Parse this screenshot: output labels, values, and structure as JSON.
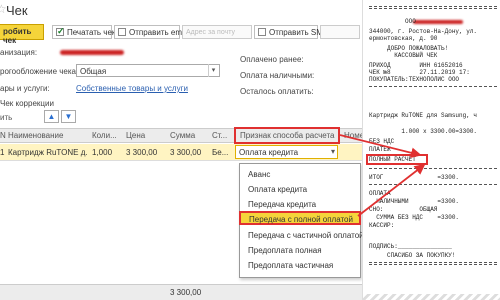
{
  "window": {
    "title": "Чек"
  },
  "toolbar": {
    "print_button": "робить чек",
    "print_check": "Печатать чек",
    "send_email": "Отправить email",
    "email_placeholder": "Адрес за почту",
    "send_sms": "Отправить SMS"
  },
  "form": {
    "org_label": "анизация:",
    "tax_label": "рогообложение чека:",
    "tax_value": "Общая",
    "goods_label": "ары и услуги:",
    "goods_link": "Собственные товары и услуги",
    "correction_label": "Чек коррекции",
    "paid_before_label": "Оплачено ранее:",
    "cash_label": "Оплата наличными:",
    "remaining_label": "Осталось оплатить:"
  },
  "grid": {
    "headers": [
      "N",
      "Наименование",
      "Коли...",
      "Цена",
      "Сумма",
      "Ст...",
      "Признак способа расчета",
      "Номе"
    ],
    "row": {
      "num": "1",
      "name": "Картридж RuTONE д...",
      "qty": "1,000",
      "price": "3 300,00",
      "sum": "3 300,00",
      "tax": "Бе...",
      "method": "Оплата кредита"
    },
    "footer_sum": "3 300,00"
  },
  "dropdown": {
    "items": [
      "Аванс",
      "Оплата кредита",
      "Передача кредита",
      "Передача с полной оплатой",
      "Передача с частичной оплатой",
      "Предоплата полная",
      "Предоплата частичная"
    ],
    "selected_index": 3
  },
  "receipt": {
    "lines": [
      "          ООО",
      "344000, г. Ростов-На-Дону, ул.",
      "ермонтовская, д. 90",
      "     ДОБРО ПОЖАЛОВАТЬ!",
      "       КАССОВЫЙ ЧЕК",
      "ПРИХОД        ИНН 61652016",
      "ЧЕК №8        27.11.2019 17:",
      "ПОКУПАТЕЛЬ:ТЕХНОПОЛИС ООО",
      "",
      "Картридж RuTONE для Samsung, ч",
      "         1.000 х 3300.00=3300.",
      "БЕЗ НДС",
      "ПЛАТЕЖ",
      "ПОЛНЫЙ РАСЧЕТ",
      "",
      "ИТОГ               =3300.",
      "",
      "ОПЛАТА",
      "  НАЛИЧНЫМИ        =3300.",
      "СНО:          ОБЩАЯ",
      "  СУММА БЕЗ НДС    =3300.",
      "КАССИР:",
      "",
      "ПОДПИСЬ:_______________",
      "     СПАСИБО ЗА ПОКУПКУ!"
    ]
  },
  "colors": {
    "accent": "#f5d43a",
    "highlight": "#e03030",
    "row_selected": "#fff4c2"
  }
}
